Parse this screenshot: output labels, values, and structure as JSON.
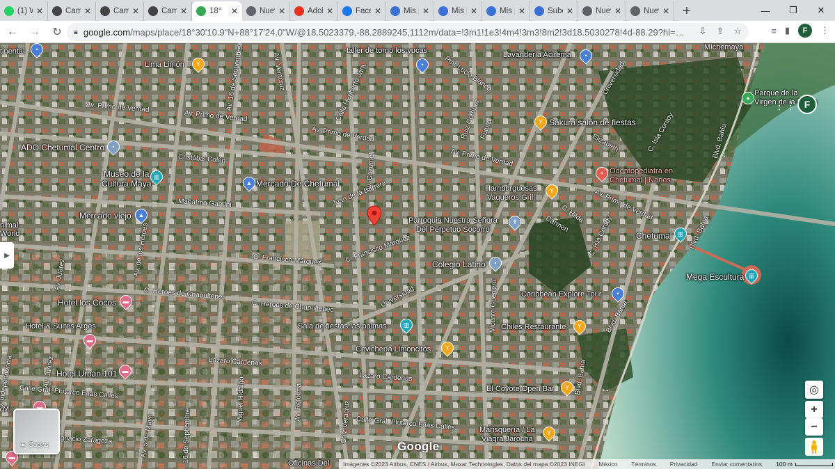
{
  "tabs": [
    {
      "label": "(1) Wh",
      "icon": "whatsapp-icon",
      "color": "#25d366"
    },
    {
      "label": "CamSc",
      "icon": "camscanner-icon",
      "color": "#444444"
    },
    {
      "label": "CamSc",
      "icon": "camscanner-icon",
      "color": "#444444"
    },
    {
      "label": "CamSc",
      "icon": "camscanner-icon",
      "color": "#444444"
    },
    {
      "label": "18°",
      "icon": "maps-pin-icon",
      "color": "#34a853",
      "active": true
    },
    {
      "label": "Nueva",
      "icon": "chrome-icon",
      "color": "#5f6368"
    },
    {
      "label": "Adobe",
      "icon": "adobe-icon",
      "color": "#e8321e"
    },
    {
      "label": "Facebo",
      "icon": "facebook-icon",
      "color": "#1877f2"
    },
    {
      "label": "Mis pro",
      "icon": "pro-icon",
      "color": "#3b6fd6"
    },
    {
      "label": "Mis pro",
      "icon": "pro-icon",
      "color": "#3b6fd6"
    },
    {
      "label": "Mis pro",
      "icon": "pro-icon",
      "color": "#3b6fd6"
    },
    {
      "label": "Sube fo",
      "icon": "pro-icon",
      "color": "#3b6fd6"
    },
    {
      "label": "Nueva",
      "icon": "chrome-icon",
      "color": "#5f6368"
    },
    {
      "label": "Nueva",
      "icon": "chrome-icon",
      "color": "#5f6368"
    }
  ],
  "browser": {
    "url_host": "google.com",
    "url_rest": "/maps/place/18°30'10.9\"N+88°17'24.0\"W/@18.5023379,-88.2889245,1112m/data=!3m1!1e3!4m4!3m3!8m2!3d18.5030278!4d-88.29?hl=es&entry...",
    "profile_initial": "F",
    "new_tab": "+",
    "back": "←",
    "forward": "→",
    "reload": "↻"
  },
  "map": {
    "profile_initial": "F",
    "layers_label": "Capas",
    "google_logo": "Google",
    "footer": {
      "attribution": "Imágenes ©2023 Airbus, CNES / Airbus, Maxar Technologies, Datos del mapa ©2023 INEGI",
      "country": "México",
      "terms": "Términos",
      "privacy": "Privacidad",
      "feedback": "Enviar comentarios",
      "scale": "100 m"
    },
    "places": {
      "taller": "taller de torno los yucas",
      "lavanderia": "Lavandería Acirema",
      "michemaya": "Michemaya",
      "lima_limon": "Lima Limón",
      "parque_virgen": "Parque de la\nVirgen de la Bahía",
      "sakura": "Sakura salón de fiestas",
      "ado": "ADO Chetumal Centro",
      "museo": "Museo de la\nCultura Maya",
      "mercado_chetumal": "Mercado De Chetumal",
      "odonto": "Odontopediatra en\nChetumal | Nanos...",
      "hamburguesas": "Hamburguesas\nVaqueros Grill",
      "mercado_viejo": "Mercado viejo",
      "parroquia": "Parroquia Nuestra Señora\nDel Perpetuo Socorro",
      "chetumal": "Chetumal",
      "colegio": "Colegio Latino",
      "mega_escultura": "Mega Escultura",
      "caribbean": "Caribbean Explore Tour",
      "hotel_cocos": "Hotel los Cocos",
      "hotel_arges": "Hotel & Suites Arges",
      "sala_palmas": "Sala de fiestas las palmas",
      "chiles": "Chiles Restaurante",
      "cevicheria": "Cevichería Limoncitos",
      "hotel_urban": "Hotel Urban 101",
      "coyote": "El Coyote Open Bar",
      "marisqueria": "Marisquería / La\nViagra Jarocha",
      "museo_partial": "nimal\nWorld",
      "continental_partial": "tinental",
      "oficinas_partial": "Oficinas Del",
      "mc_partial": "M"
    },
    "streets": {
      "primo1": "Av. Primo de Verdad",
      "primo2": "Av. Primo de Verdad",
      "primo3": "Av. Primo de Verdad",
      "primo4": "Av. Primo de Verdad",
      "primo5": "Av. Primo de Verdad",
      "cristobal": "Cristóbal Colón",
      "mahatma": "Mahatma Gandhi",
      "juan": "Juan de la Barrera",
      "francisco1": "C. Francisco Márquez",
      "francisco2": "C. Francisco Márquez",
      "heroes1": "C. Héroes de Chapultepec",
      "heroes2": "C. Héroes de Chapultepec",
      "universidad": "Universidad",
      "universidad2": "Universidad",
      "lazaro1": "Lázaro Cárdenas",
      "lazaro2": "Lázaro Cárdenas",
      "plutarco1": "Calle Gral. Plutarco Elías Calles",
      "plutarco2": "Calle Gral. Plutarco Elías Calles",
      "zaragoza": "Ignacio Zaragoza",
      "independencia": "Av. Independencia",
      "juarez": "Av. Juárez",
      "juarez2": "Av. Juárez",
      "heroes_av": "Av. de los Héroes",
      "heroes_av2": "Av. de los Héroes",
      "mayo": "Av. 5 de Mayo",
      "septiembre": "16 de Septiembre",
      "septiembre2": "Av. 16 de Septiembre",
      "hidalgo": "Miguel Hidalgo",
      "reforma": "Av. Reforma",
      "veracruz": "Calz Veracruz",
      "veracruz2": "Av. Veracruz",
      "cozumel": "Av. Cozumel",
      "heriberto": "Calle Heriberto Jara",
      "lucio": "Priv. Lucio Blanco",
      "ruiz": "Ruiz Cortínez",
      "vicente": "Vicente Guerrero",
      "elizabeth": "Elizabeth",
      "contoy": "C. Isla Contoy",
      "contoy2": "C. Isla Contoy",
      "hilda": "C. Hilda",
      "carmen": "Carmen",
      "bahia1": "Blvd. Bahía",
      "bahia2": "Blvd. Bahía",
      "bahia3": "Blvd. Bahía",
      "bahia4": "Blvd. Bahía",
      "universitad": "Universidad",
      "futura": "Futura"
    }
  }
}
